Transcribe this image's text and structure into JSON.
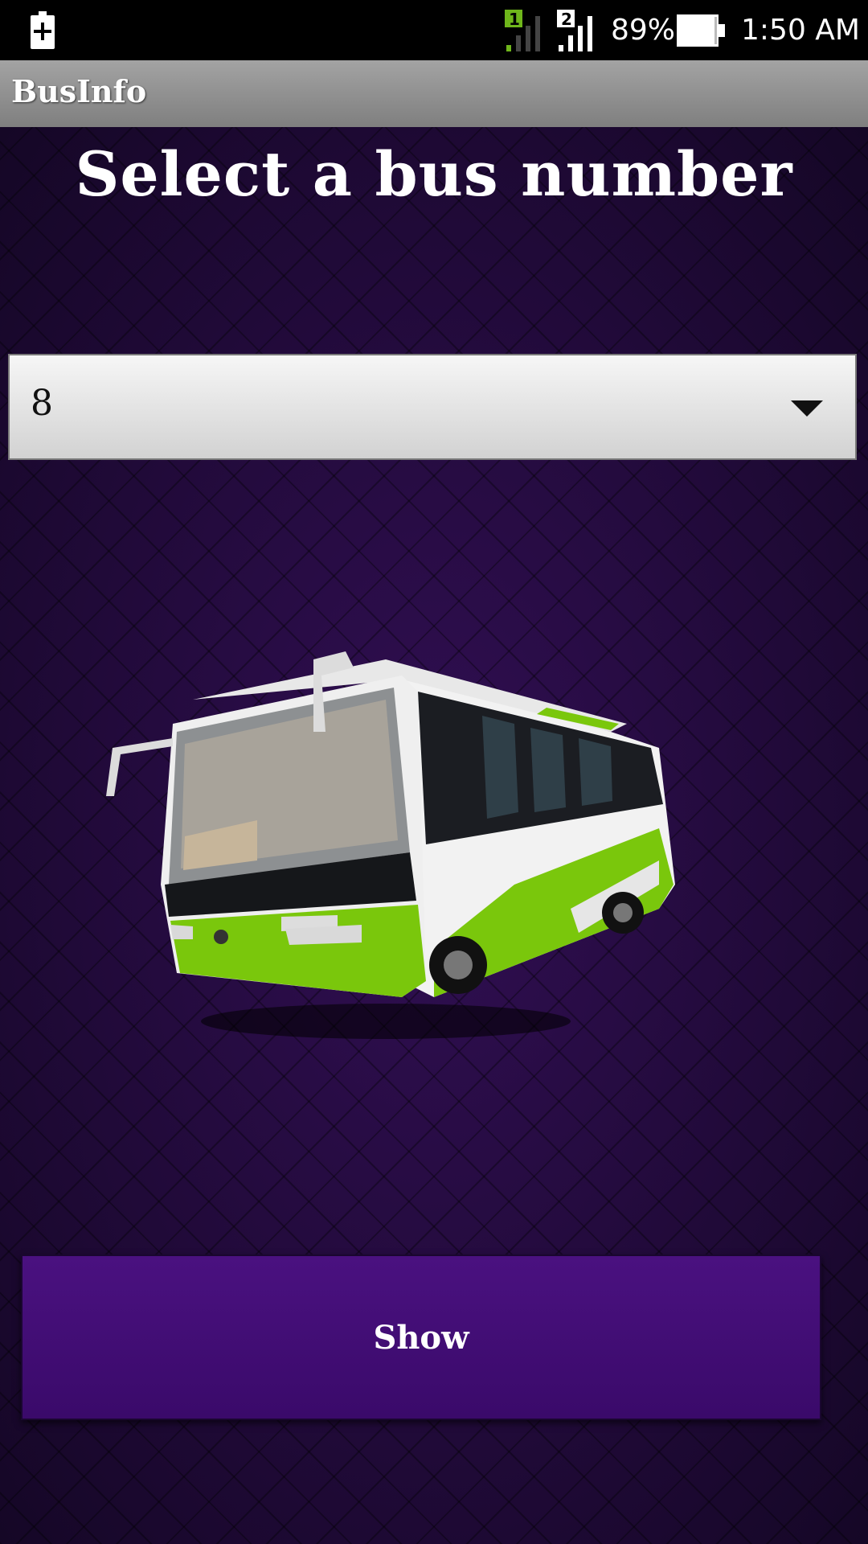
{
  "status_bar": {
    "battery_percent": "89%",
    "time": "1:50 AM",
    "sim1_label": "1",
    "sim2_label": "2",
    "icons": [
      "battery-saver-icon",
      "signal-sim1-icon",
      "signal-sim2-icon",
      "battery-icon"
    ]
  },
  "app_bar": {
    "title": "BusInfo"
  },
  "main": {
    "heading": "Select a bus number",
    "spinner": {
      "selected_value": "8"
    },
    "image": {
      "icon": "bus-icon"
    },
    "show_button": {
      "label": "Show"
    }
  },
  "colors": {
    "background": "#260c45",
    "button": "#4a1180",
    "bus_green": "#7ac70c"
  }
}
